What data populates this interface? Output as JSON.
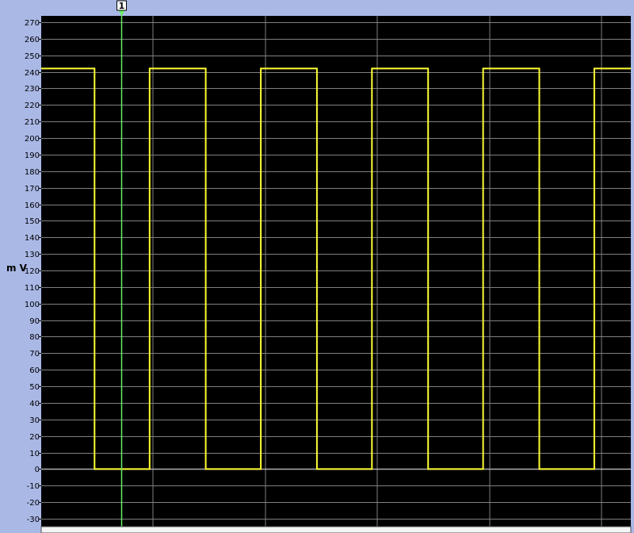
{
  "chart_data": {
    "type": "line",
    "title": "",
    "xlabel": "",
    "ylabel": "m V",
    "ylim": [
      -30,
      275
    ],
    "y_ticks": [
      270,
      260,
      250,
      240,
      230,
      220,
      210,
      200,
      190,
      180,
      170,
      160,
      150,
      140,
      130,
      120,
      110,
      100,
      90,
      80,
      70,
      60,
      50,
      40,
      30,
      20,
      10,
      0,
      -10,
      -20,
      -30
    ],
    "grid": true,
    "zero_line": true,
    "series": [
      {
        "color": "#ffff33",
        "x": [
          0,
          9.5,
          9.5,
          19.3,
          19.3,
          29.3,
          29.3,
          39.1,
          39.1,
          49.1,
          49.1,
          58.9,
          58.9,
          68.9,
          68.9,
          78.7,
          78.7,
          88.7,
          88.7,
          98.5,
          98.5,
          105
        ],
        "values": [
          242,
          242,
          0,
          0,
          242,
          242,
          0,
          0,
          242,
          242,
          0,
          0,
          242,
          242,
          0,
          0,
          242,
          242,
          0,
          0,
          242,
          242
        ]
      }
    ],
    "cursor": {
      "label": "1",
      "x": 14.2,
      "color": "#66ee66"
    }
  },
  "colors": {
    "background": "#aab8e6",
    "plot_background": "#000000",
    "grid": "#808080",
    "zero_line": "#b0b0b0",
    "trace": "#ffff33",
    "cursor": "#66ee66"
  }
}
